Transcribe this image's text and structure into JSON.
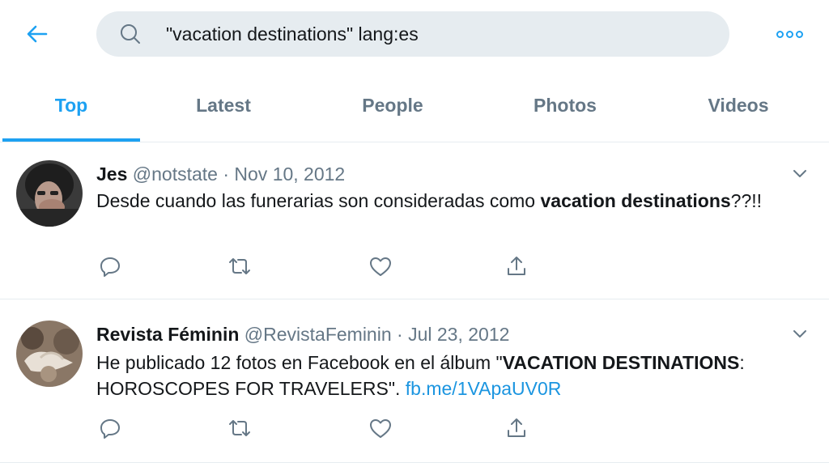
{
  "header": {
    "back_icon": "arrow-left-icon",
    "search_icon": "search-icon",
    "search_value": "\"vacation destinations\" lang:es",
    "more_icon": "more-horizontal-icon",
    "accent_color": "#1da1f2"
  },
  "tabs": [
    {
      "label": "Top",
      "active": true
    },
    {
      "label": "Latest",
      "active": false
    },
    {
      "label": "People",
      "active": false
    },
    {
      "label": "Photos",
      "active": false
    },
    {
      "label": "Videos",
      "active": false
    }
  ],
  "tweets": [
    {
      "name": "Jes",
      "handle": "@notstate",
      "separator": "·",
      "date": "Nov 10, 2012",
      "text_segments": [
        {
          "text": "Desde cuando las funerarias son consideradas como ",
          "bold": false
        },
        {
          "text": "vacation destinations",
          "bold": true
        },
        {
          "text": "??!!",
          "bold": false
        }
      ]
    },
    {
      "name": "Revista Féminin",
      "handle": "@RevistaFeminin",
      "separator": "·",
      "date": "Jul 23, 2012",
      "text_segments": [
        {
          "text": "He publicado 12 fotos en Facebook en el álbum \"",
          "bold": false
        },
        {
          "text": "VACATION DESTINATIONS",
          "bold": true
        },
        {
          "text": ": HOROSCOPES FOR TRAVELERS\". ",
          "bold": false
        },
        {
          "text": "fb.me/1VApaUV0R",
          "link": true
        }
      ]
    }
  ],
  "action_icons": [
    "reply-icon",
    "retweet-icon",
    "like-icon",
    "share-icon"
  ],
  "colors": {
    "text_primary": "#14171a",
    "text_secondary": "#657786",
    "link": "#1b95e0",
    "divider": "#e6ecf0",
    "search_bg": "#e6ecf0"
  }
}
